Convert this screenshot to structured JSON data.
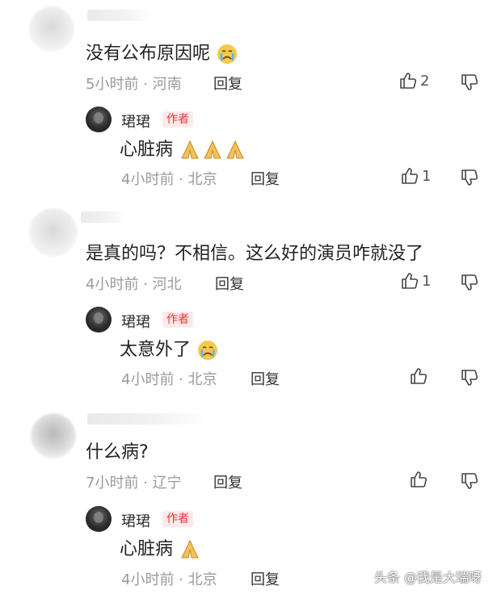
{
  "comments": [
    {
      "text": "没有公布原因呢",
      "emoji": "crying-face",
      "time": "5小时前",
      "location": "河南",
      "reply": "回复",
      "likes": "2",
      "author_reply": {
        "name": "珺珺",
        "badge": "作者",
        "text": "心脏病",
        "emojis": [
          "folded-hands",
          "folded-hands",
          "folded-hands"
        ],
        "time": "4小时前",
        "location": "北京",
        "reply": "回复",
        "likes": "1"
      }
    },
    {
      "text": "是真的吗？不相信。这么好的演员咋就没了",
      "time": "4小时前",
      "location": "河北",
      "reply": "回复",
      "likes": "1",
      "author_reply": {
        "name": "珺珺",
        "badge": "作者",
        "text": "太意外了",
        "emojis": [
          "crying-face"
        ],
        "time": "4小时前",
        "location": "北京",
        "reply": "回复",
        "likes": ""
      }
    },
    {
      "text": "什么病?",
      "time": "7小时前",
      "location": "辽宁",
      "reply": "回复",
      "likes": "",
      "author_reply": {
        "name": "珺珺",
        "badge": "作者",
        "text": "心脏病",
        "emojis": [
          "folded-hands"
        ],
        "time": "4小时前",
        "location": "北京",
        "reply": "回复",
        "likes": ""
      }
    }
  ],
  "separator": " · ",
  "watermark": "头条 @我是大瑞呀",
  "colors": {
    "badge_text": "#e8323c",
    "badge_bg": "#ffe9ea",
    "meta": "#9a9a9a"
  }
}
